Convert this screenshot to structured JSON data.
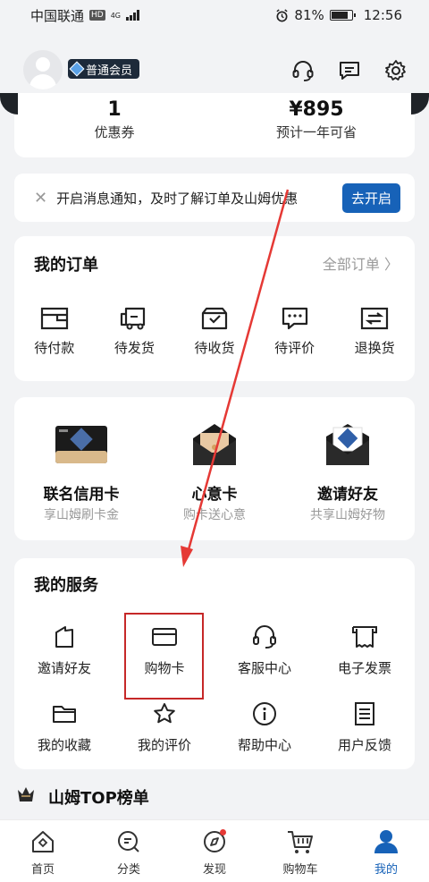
{
  "status_bar": {
    "carrier": "中国联通",
    "hd": "HD",
    "network": "4G",
    "battery": "81%",
    "time": "12:56"
  },
  "header": {
    "member_level": "普通会员"
  },
  "stats": {
    "coupons": {
      "value": "1",
      "label": "优惠券"
    },
    "savings": {
      "value": "¥895",
      "label": "预计一年可省"
    }
  },
  "notify": {
    "text": "开启消息通知，及时了解订单及山姆优惠",
    "button": "去开启"
  },
  "orders": {
    "title": "我的订单",
    "all_link": "全部订单",
    "items": [
      {
        "label": "待付款",
        "icon": "wallet-icon"
      },
      {
        "label": "待发货",
        "icon": "delivery-truck-icon"
      },
      {
        "label": "待收货",
        "icon": "package-box-icon"
      },
      {
        "label": "待评价",
        "icon": "comment-icon"
      },
      {
        "label": "退换货",
        "icon": "exchange-icon"
      }
    ]
  },
  "promos": [
    {
      "title": "联名信用卡",
      "subtitle": "享山姆刷卡金"
    },
    {
      "title": "心意卡",
      "subtitle": "购卡送心意"
    },
    {
      "title": "邀请好友",
      "subtitle": "共享山姆好物"
    }
  ],
  "services": {
    "title": "我的服务",
    "items": [
      {
        "label": "邀请好友",
        "icon": "invite-icon"
      },
      {
        "label": "购物卡",
        "icon": "card-icon"
      },
      {
        "label": "客服中心",
        "icon": "headset-icon"
      },
      {
        "label": "电子发票",
        "icon": "invoice-icon"
      },
      {
        "label": "我的收藏",
        "icon": "folder-icon"
      },
      {
        "label": "我的评价",
        "icon": "star-icon"
      },
      {
        "label": "帮助中心",
        "icon": "info-icon"
      },
      {
        "label": "用户反馈",
        "icon": "feedback-icon"
      }
    ]
  },
  "top_list": {
    "title": "山姆TOP榜单"
  },
  "nav": [
    {
      "label": "首页",
      "icon": "home-icon"
    },
    {
      "label": "分类",
      "icon": "category-search-icon"
    },
    {
      "label": "发现",
      "icon": "compass-icon"
    },
    {
      "label": "购物车",
      "icon": "cart-icon"
    },
    {
      "label": "我的",
      "icon": "profile-icon"
    }
  ],
  "colors": {
    "accent": "#1762b8",
    "annotation": "#c62828",
    "badge_bg": "#1d2a3a"
  }
}
